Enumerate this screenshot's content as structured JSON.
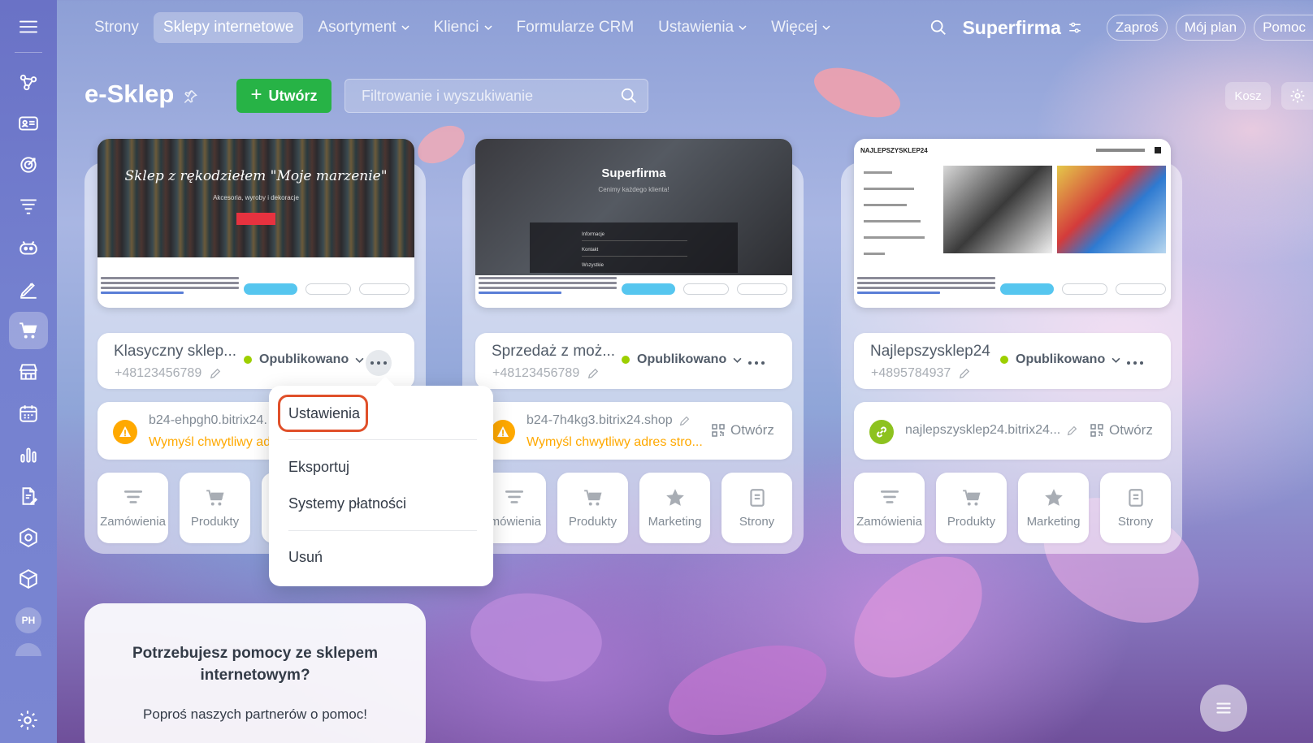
{
  "nav": {
    "tabs": [
      {
        "label": "Strony"
      },
      {
        "label": "Sklepy internetowe"
      },
      {
        "label": "Asortyment"
      },
      {
        "label": "Klienci"
      },
      {
        "label": "Formularze CRM"
      },
      {
        "label": "Ustawienia"
      },
      {
        "label": "Więcej"
      }
    ],
    "brand": "Superfirma",
    "invite": "Zaproś",
    "plan": "Mój plan",
    "help": "Pomoc"
  },
  "sidebar": {
    "avatar": "PH"
  },
  "header": {
    "title": "e-Sklep",
    "create_label": "Utwórz",
    "search_placeholder": "Filtrowanie i wyszukiwanie",
    "trash_label": "Kosz"
  },
  "shops": [
    {
      "preview_title": "Sklep z rękodziełem \"Moje marzenie\"",
      "preview_subtitle": "Akcesoria, wyroby i dekoracje",
      "name": "Klasyczny sklep...",
      "phone": "+48123456789",
      "status": "Opublikowano",
      "domain": "b24-ehpgh0.bitrix24.",
      "domain_warning": "Wymyśl chwytliwy ad"
    },
    {
      "preview_title": "Superfirma",
      "preview_subtitle": "Cenimy każdego klienta!",
      "preview_menu": [
        "Informacje",
        "Kontakt",
        "Wszystkie"
      ],
      "name": "Sprzedaż z moż...",
      "phone": "+48123456789",
      "status": "Opublikowano",
      "domain": "b24-7h4kg3.bitrix24.shop",
      "domain_warning": "Wymyśl chwytliwy adres stro...",
      "open_label": "Otwórz"
    },
    {
      "preview_title": "NAJLEPSZYSKLEP24",
      "name": "Najlepszysklep24",
      "phone": "+4895784937",
      "status": "Opublikowano",
      "domain": "najlepszysklep24.bitrix24...",
      "open_label": "Otwórz"
    }
  ],
  "actions": {
    "orders": "Zamówienia",
    "orders_cut": "mówienia",
    "products": "Produkty",
    "marketing": "Marketing",
    "pages": "Strony"
  },
  "menu": {
    "settings": "Ustawienia",
    "export": "Eksportuj",
    "payments": "Systemy płatności",
    "delete": "Usuń"
  },
  "help": {
    "title": "Potrzebujesz pomocy ze sklepem internetowym?",
    "text": "Poproś naszych partnerów o pomoc!"
  },
  "colors": {
    "accent_green": "#27b346",
    "status_green": "#9dcf00",
    "warning": "#ffa900",
    "highlight": "#e0502a"
  }
}
